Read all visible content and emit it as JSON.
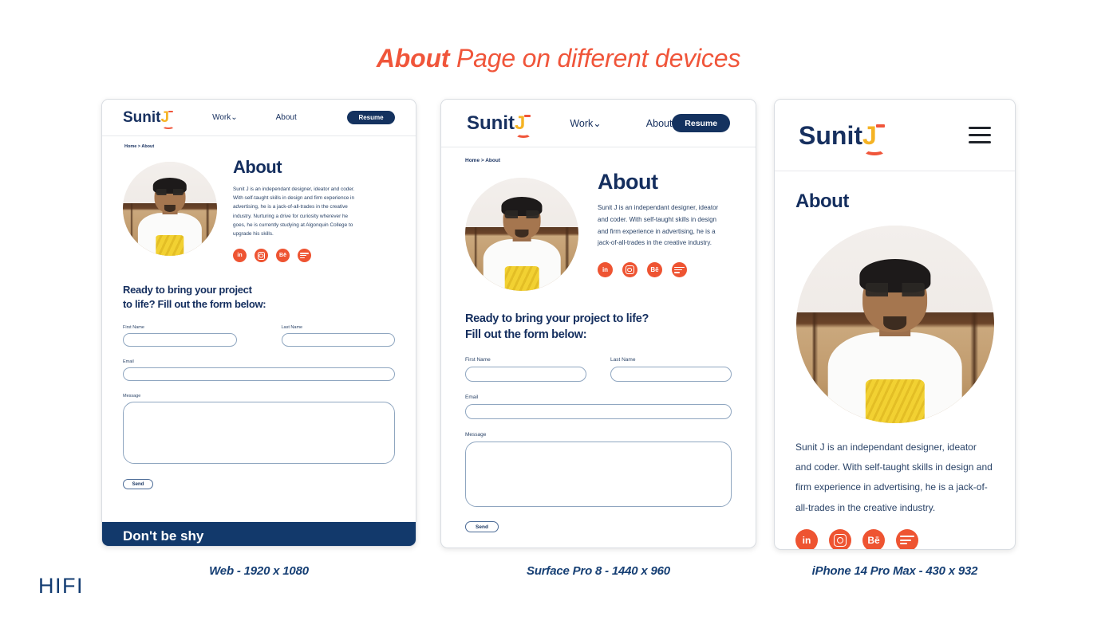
{
  "page": {
    "title_strong": "About",
    "title_rest": " Page on different devices",
    "fidelity_label": "HIFI",
    "accent_orange": "#F0553A",
    "social_orange": "#EE5432",
    "navy": "#14325F",
    "logo_yellow": "#F5B324"
  },
  "site": {
    "logo_text": "Sunit",
    "logo_mark": "J",
    "nav": [
      {
        "label": "Work",
        "caret": "⌄"
      },
      {
        "label": "About"
      }
    ],
    "resume_label": "Resume",
    "breadcrumb": "Home > About",
    "about_heading": "About",
    "about_body_web": "Sunit J is an independant designer, ideator and coder. With self-taught skills in design and firm experience in advertising, he is a jack-of-all-trades in the creative industry. Nurturing a drive for curiosity wherever he goes, he is currently studying at Algonquin College to upgrade his skills.",
    "about_body_short": "Sunit J is an independant designer, ideator and coder. With self-taught skills in design and firm experience in advertising, he is a jack-of-all-trades in the creative industry.",
    "socials": [
      {
        "name": "linkedin",
        "glyph": "in"
      },
      {
        "name": "instagram",
        "glyph": ""
      },
      {
        "name": "behance",
        "glyph": "Bē"
      },
      {
        "name": "spotify",
        "glyph": ""
      }
    ],
    "form": {
      "heading_web_line1": "Ready to bring your project",
      "heading_web_line2": "to life? Fill out the form below:",
      "heading_surface_line1": "Ready to bring your project to life?",
      "heading_surface_line2": "Fill out the form below:",
      "first_name_label": "First Name",
      "last_name_label": "Last Name",
      "email_label": "Email",
      "message_label": "Message",
      "first_name_value": "",
      "last_name_value": "",
      "email_value": "",
      "message_value": "",
      "send_label": "Send"
    },
    "footer_heading": "Don't be shy"
  },
  "devices": [
    {
      "id": "web",
      "caption": "Web - 1920 x 1080"
    },
    {
      "id": "surface",
      "caption": "Surface Pro 8 - 1440 x 960"
    },
    {
      "id": "mobile",
      "caption": "iPhone 14 Pro Max - 430 x 932"
    }
  ]
}
